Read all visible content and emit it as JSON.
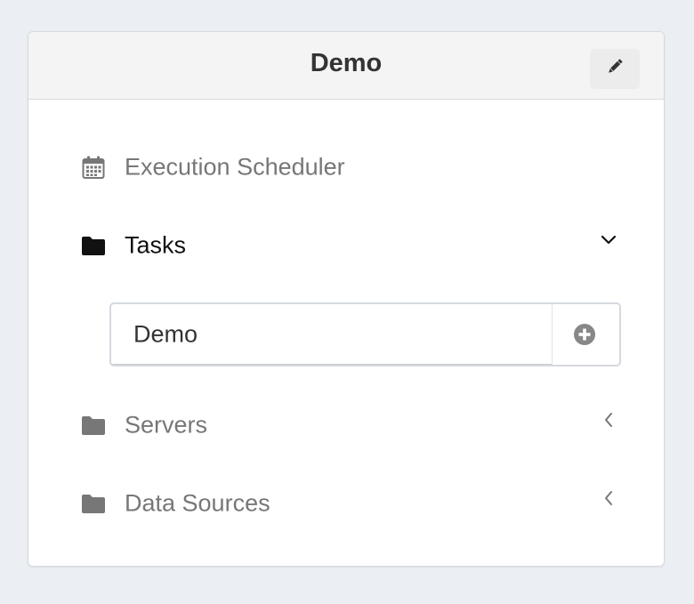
{
  "header": {
    "title": "Demo",
    "edit_icon": "pencil-icon"
  },
  "nav": {
    "items": [
      {
        "label": "Execution Scheduler",
        "icon": "calendar-icon",
        "chevron": "none",
        "active": false
      },
      {
        "label": "Tasks",
        "icon": "folder-icon",
        "chevron": "down",
        "active": true
      },
      {
        "label": "Servers",
        "icon": "folder-icon",
        "chevron": "left",
        "active": false
      },
      {
        "label": "Data Sources",
        "icon": "folder-icon",
        "chevron": "left",
        "active": false
      }
    ],
    "tasks_children": [
      {
        "label": "Demo",
        "action_icon": "plus-circle-icon"
      }
    ]
  },
  "colors": {
    "background": "#ebeef3",
    "header_bg": "#f4f4f4",
    "muted_text": "#777777",
    "active_text": "#111111",
    "title_text": "#333333"
  }
}
